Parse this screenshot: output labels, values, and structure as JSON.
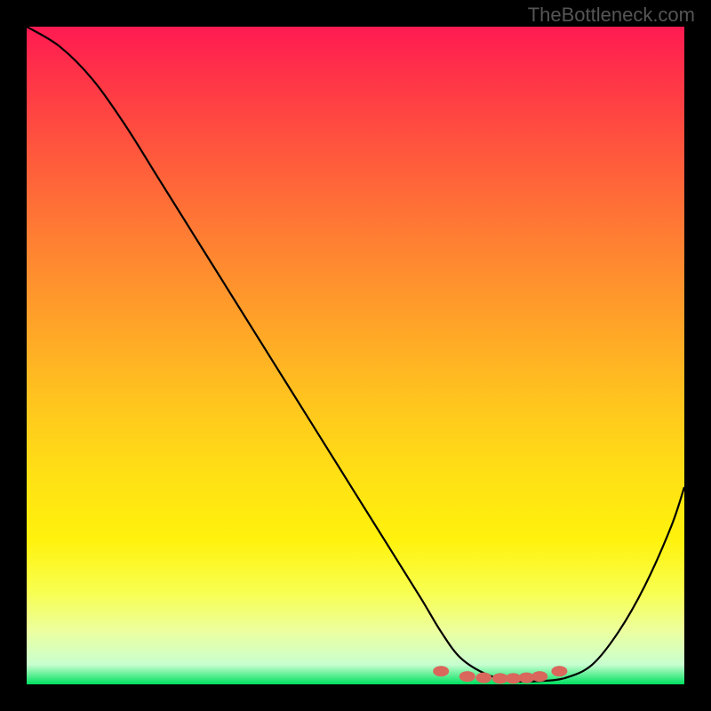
{
  "watermark": "TheBottleneck.com",
  "chart_data": {
    "type": "line",
    "title": "",
    "xlabel": "",
    "ylabel": "",
    "xlim": [
      0,
      100
    ],
    "ylim": [
      0,
      100
    ],
    "series": [
      {
        "name": "curve",
        "x": [
          0,
          5,
          10,
          15,
          20,
          25,
          30,
          35,
          40,
          45,
          50,
          55,
          60,
          63,
          66,
          70,
          74,
          78,
          82,
          86,
          90,
          94,
          98,
          100
        ],
        "y": [
          100,
          97,
          92,
          85,
          77,
          69,
          61,
          53,
          45,
          37,
          29,
          21,
          13,
          8,
          4,
          1.5,
          0.5,
          0.5,
          1,
          3,
          8,
          15,
          24,
          30
        ]
      }
    ],
    "markers": {
      "name": "dots",
      "x": [
        63,
        67,
        69.5,
        72,
        74,
        76,
        78,
        81
      ],
      "y": [
        2.0,
        1.2,
        1.0,
        0.9,
        0.9,
        1.0,
        1.2,
        2.0
      ]
    },
    "background_gradient": {
      "stops": [
        {
          "pos": 0.0,
          "color": "#ff1a52"
        },
        {
          "pos": 0.5,
          "color": "#ffc21f"
        },
        {
          "pos": 0.85,
          "color": "#fcff40"
        },
        {
          "pos": 1.0,
          "color": "#00e060"
        }
      ]
    }
  }
}
